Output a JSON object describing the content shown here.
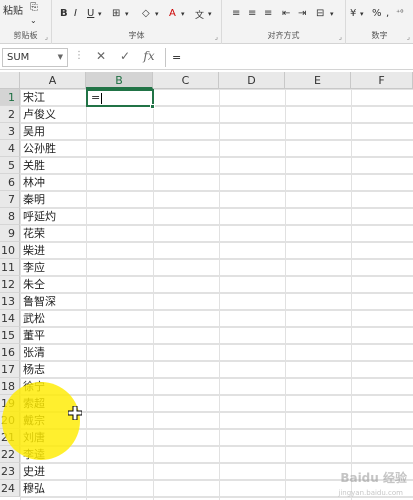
{
  "ribbon": {
    "paste_label": "粘贴",
    "clipboard_label": "剪贴板",
    "font_label": "字体",
    "alignment_label": "对齐方式",
    "number_label": "数字",
    "percent_symbol": "%",
    "comma_symbol": ","
  },
  "formula_bar": {
    "name_box": "SUM",
    "cancel_icon": "✕",
    "enter_icon": "✓",
    "fx_label": "fx",
    "formula": "="
  },
  "sheet": {
    "columns": [
      "A",
      "B",
      "C",
      "D",
      "E",
      "F"
    ],
    "rows": [
      "1",
      "2",
      "3",
      "4",
      "5",
      "6",
      "7",
      "8",
      "9",
      "10",
      "11",
      "12",
      "13",
      "14",
      "15",
      "16",
      "17",
      "18",
      "19",
      "20",
      "21",
      "22",
      "23",
      "24"
    ],
    "column_a": [
      "宋江",
      "卢俊义",
      "吴用",
      "公孙胜",
      "关胜",
      "林冲",
      "秦明",
      "呼延灼",
      "花荣",
      "柴进",
      "李应",
      "朱仝",
      "鲁智深",
      "武松",
      "董平",
      "张清",
      "杨志",
      "徐宁",
      "索超",
      "戴宗",
      "刘唐",
      "李逵",
      "史进",
      "穆弘"
    ],
    "active_cell_value": "=",
    "active_cell": "B1"
  },
  "watermark": {
    "text": "Baidu 经验",
    "sub": "jingyan.baidu.com"
  },
  "colors": {
    "accent": "#217346",
    "highlight": "#ffec00"
  }
}
